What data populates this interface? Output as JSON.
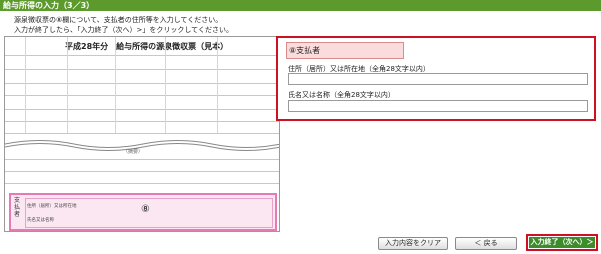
{
  "header": {
    "title": "給与所得の入力（3／3）"
  },
  "instructions": {
    "line1": "源泉徴収票の⑧欄について、支払者の住所等を入力してください。",
    "line2": "入力が終了したら、「入力終了（次へ）>」をクリックしてください。"
  },
  "form_sample": {
    "title": "平成28年分　給与所得の源泉徴収票（見本）",
    "marker": "⑧",
    "payer_side_label": "支払者",
    "payer_address_label": "住所（居所）又は所在地",
    "payer_name_label": "氏名又は名称",
    "mid_label": "（摘要）"
  },
  "panel": {
    "section_label": "⑧支払者",
    "address_label": "住所（居所）又は所在地（全角28文字以内）",
    "address_value": "",
    "name_label": "氏名又は名称（全角28文字以内）",
    "name_value": ""
  },
  "buttons": {
    "clear": "入力内容をクリア",
    "back": "＜ 戻る",
    "next": "入力終了（次へ）＞"
  }
}
